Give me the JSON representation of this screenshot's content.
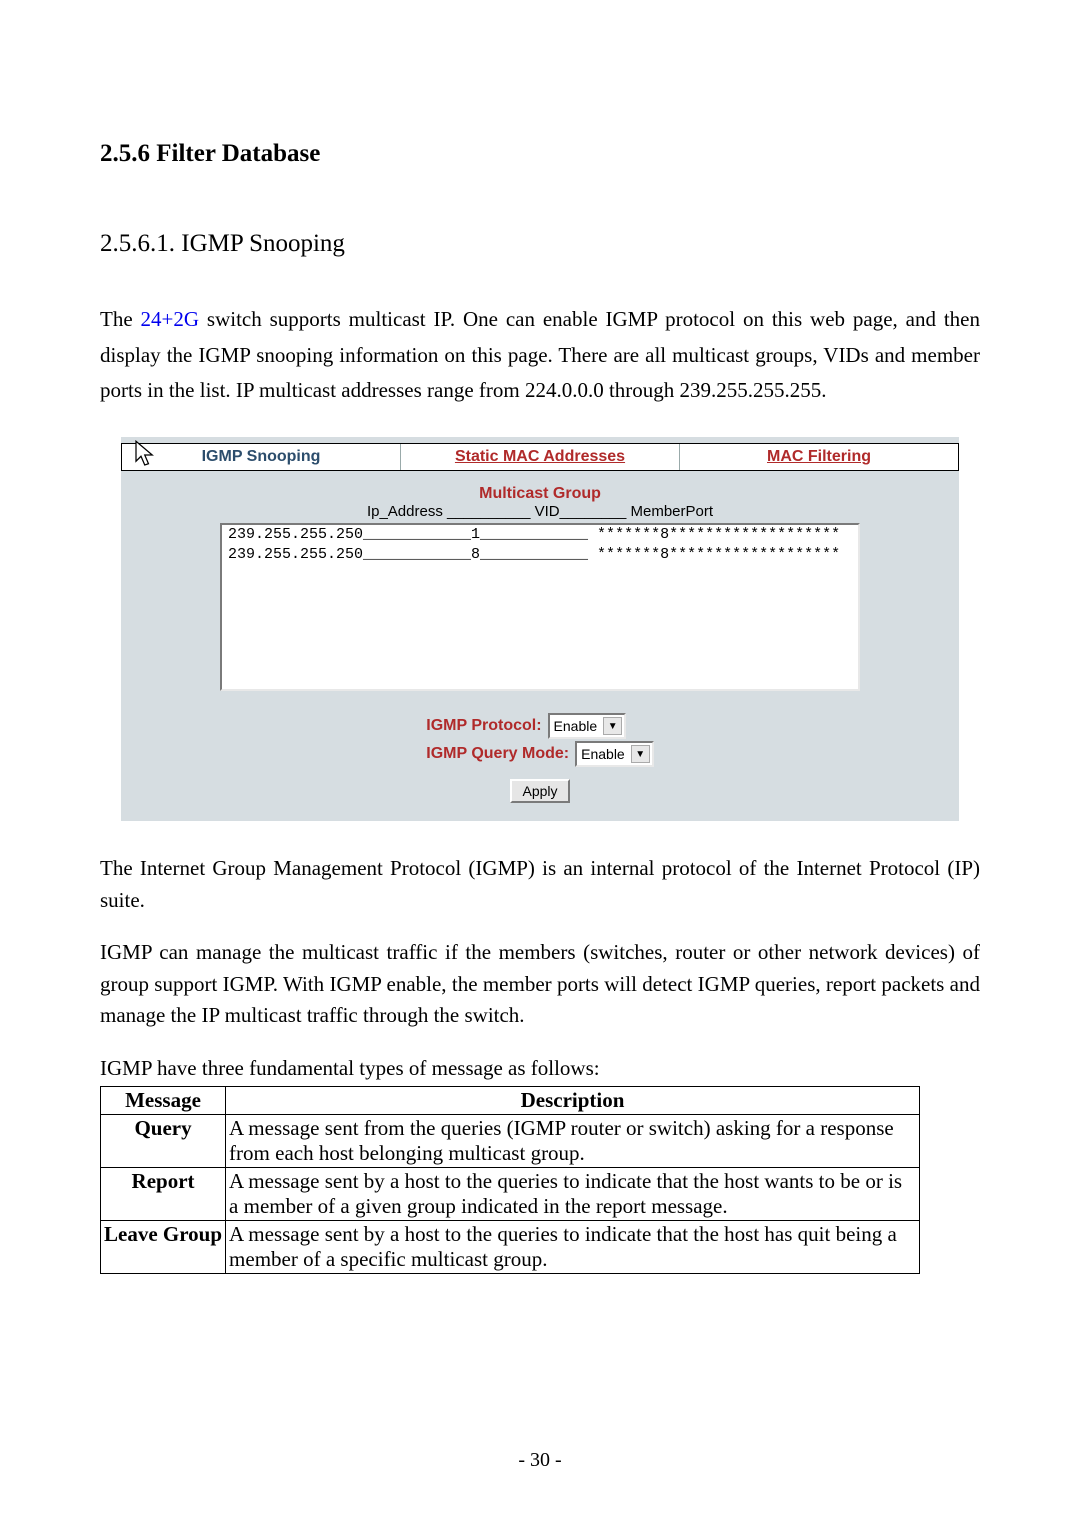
{
  "headings": {
    "h1": "2.5.6 Filter Database",
    "h2": "2.5.6.1. IGMP Snooping"
  },
  "intro": {
    "pre_link": "The ",
    "link": "24+2G",
    "post_link": " switch supports multicast IP. One can enable IGMP protocol on this web page, and then display the IGMP snooping information on this page. There are all multicast groups, VIDs and member ports in the list. IP multicast addresses range from 224.0.0.0 through 239.255.255.255."
  },
  "screenshot": {
    "tabs": {
      "active": "IGMP Snooping",
      "static": "Static MAC Addresses",
      "filtering": "MAC Filtering"
    },
    "box_title": "Multicast Group",
    "box_headers": "Ip_Address __________ VID________ MemberPort",
    "rows": [
      "239.255.255.250____________1____________ *******8*******************",
      "239.255.255.250____________8____________ *******8*******************"
    ],
    "form": {
      "protocol_label": "IGMP Protocol:",
      "protocol_value": "Enable",
      "query_label": "IGMP Query Mode:",
      "query_value": "Enable",
      "apply": "Apply"
    }
  },
  "body_text": {
    "p1": "The Internet Group Management Protocol (IGMP) is an internal protocol of the Internet Protocol (IP) suite.",
    "p2": "IGMP can manage the multicast traffic if the members (switches, router or other network devices) of group support IGMP. With IGMP enable, the member ports will detect IGMP queries, report packets and manage the IP multicast traffic through the switch.",
    "p3": "IGMP have three fundamental types of message as follows:"
  },
  "table": {
    "headers": {
      "msg": "Message",
      "desc": "Description"
    },
    "rows": [
      {
        "msg": "Query",
        "desc": "A message sent from the queries (IGMP router or switch) asking for a response from each host belonging multicast group."
      },
      {
        "msg": "Report",
        "desc": "A message sent by a host to the queries to indicate that the host wants to be or is a member of a given group indicated in the report message."
      },
      {
        "msg": "Leave Group",
        "desc": "A message sent by a host to the queries to indicate that the host has quit being a member of a specific multicast group."
      }
    ]
  },
  "page_number": "- 30 -"
}
